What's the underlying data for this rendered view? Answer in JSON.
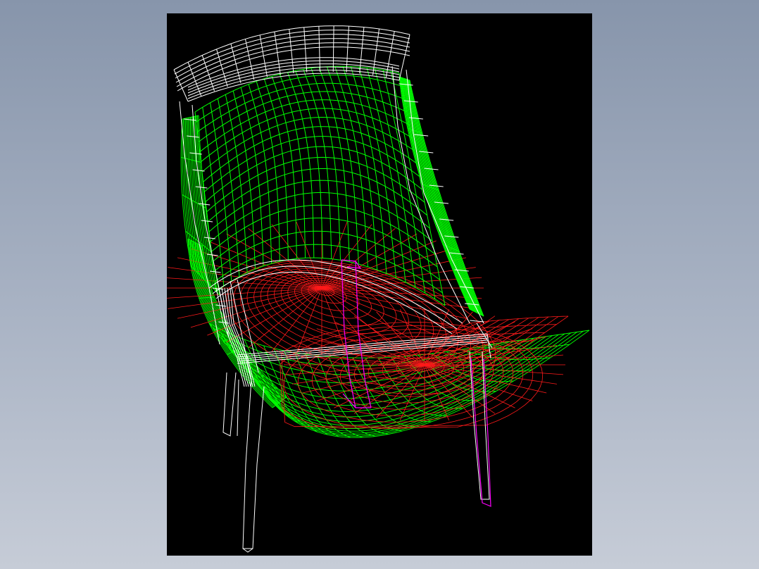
{
  "colors": {
    "page_gradient_top": "#8795ab",
    "page_gradient_bottom": "#c6ccd7",
    "viewport_background": "#000000",
    "frame_wireframe": "#ffffff",
    "backrest_mesh": "#00ff00",
    "seat_mesh": "#ff0000",
    "rear_leg": "#ff00ff"
  },
  "scene": {
    "description_icon": "chair-wireframe-icon",
    "layers": [
      "backrest-frame",
      "backrest-mesh",
      "seat-frame",
      "seat-mesh",
      "underside-mesh",
      "legs"
    ]
  }
}
